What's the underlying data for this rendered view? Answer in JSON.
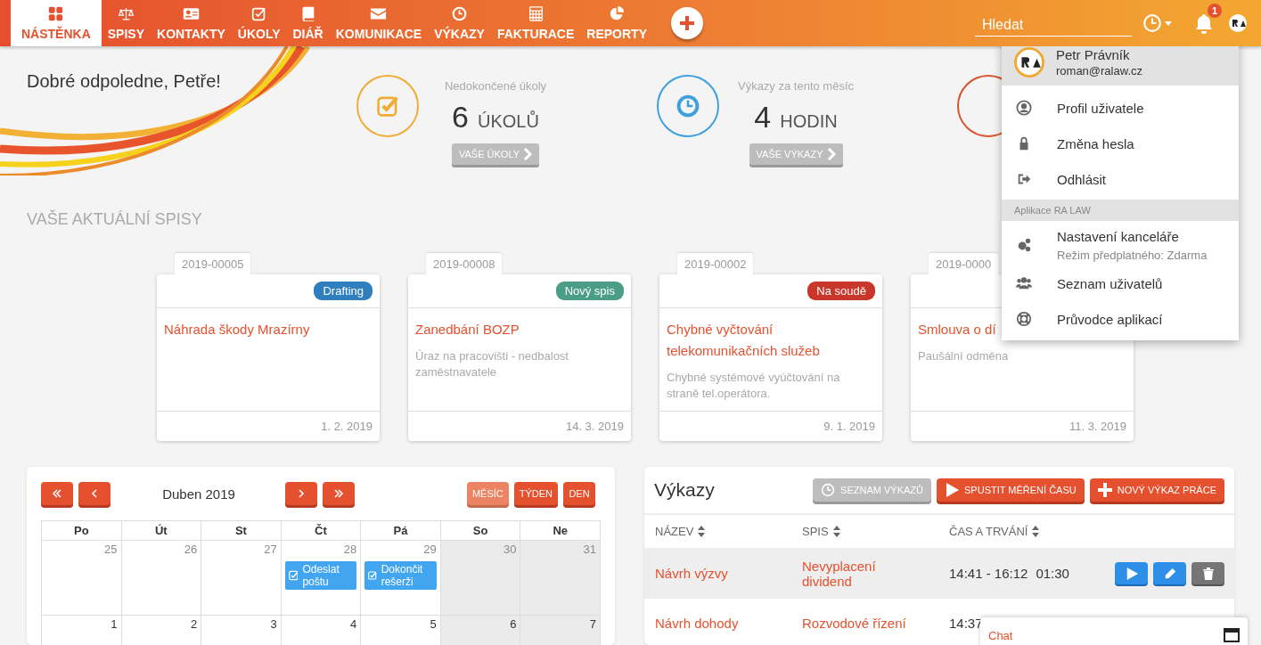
{
  "nav": {
    "items": [
      {
        "label": "NÁSTĚNKA",
        "selected": true
      },
      {
        "label": "SPISY",
        "selected": false
      },
      {
        "label": "KONTAKTY",
        "selected": false
      },
      {
        "label": "ÚKOLY",
        "selected": false
      },
      {
        "label": "DIÁŘ",
        "selected": false
      },
      {
        "label": "KOMUNIKACE",
        "selected": false
      },
      {
        "label": "VÝKAZY",
        "selected": false
      },
      {
        "label": "FAKTURACE",
        "selected": false
      },
      {
        "label": "REPORTY",
        "selected": false
      }
    ]
  },
  "search": {
    "placeholder": "Hledat"
  },
  "notifications": {
    "count": "1"
  },
  "user_menu": {
    "name": "Petr Právník",
    "email": "roman@ralaw.cz",
    "items": [
      {
        "label": "Profil uživatele"
      },
      {
        "label": "Změna hesla"
      },
      {
        "label": "Odhlásit"
      }
    ],
    "section": "Aplikace RA LAW",
    "app_items": [
      {
        "label": "Nastavení kanceláře",
        "subtitle": "Režim předplatného: Zdarma"
      },
      {
        "label": "Seznam uživatelů"
      },
      {
        "label": "Průvodce aplikací"
      }
    ]
  },
  "greeting": "Dobré odpoledne, Petře!",
  "stats": [
    {
      "label": "Nedokončené úkoly",
      "value": "6",
      "unit": "ÚKOLŮ",
      "button": "VAŠE ÚKOLY",
      "color": "#f0ac34"
    },
    {
      "label": "Výkazy za tento měsíc",
      "value": "4",
      "unit": "HODIN",
      "button": "VAŠE VÝKAZY",
      "color": "#3ea0dd"
    },
    {
      "color": "#d9532c"
    }
  ],
  "cases": {
    "title": "VAŠE AKTUÁLNÍ SPISY",
    "items": [
      {
        "number": "2019-00005",
        "status": "Drafting",
        "color": "#2f7fbf",
        "title": "Náhrada škody Mrazírny",
        "date": "1. 2. 2019"
      },
      {
        "number": "2019-00008",
        "status": "Nový spis",
        "color": "#4a9e85",
        "title": "Zanedbání BOZP",
        "description": "Úraz na pracovišti - nedbalost zaměstnavatele",
        "date": "14. 3. 2019"
      },
      {
        "number": "2019-00002",
        "status": "Na soudě",
        "color": "#c9362a",
        "title": "Chybné vyčtování telekomunikačních služeb",
        "description": "Chybné systémové vyúčtování na straně tel.operátora.",
        "date": "9. 1. 2019"
      },
      {
        "number": "2019-0000",
        "title": "Smlouva o dí",
        "description": "Paušální odměna",
        "date": "11. 3. 2019"
      }
    ]
  },
  "calendar": {
    "month": "Duben 2019",
    "views": [
      {
        "label": "MĚSÍC",
        "selected": true
      },
      {
        "label": "TÝDEN",
        "selected": false
      },
      {
        "label": "DEN",
        "selected": false
      }
    ],
    "weekdays": [
      "Po",
      "Út",
      "St",
      "Čt",
      "Pá",
      "So",
      "Ne"
    ],
    "weeks": [
      {
        "days": [
          {
            "label": "25",
            "other_month": true,
            "weekend": false
          },
          {
            "label": "26",
            "other_month": true,
            "weekend": false
          },
          {
            "label": "27",
            "other_month": true,
            "weekend": false
          },
          {
            "label": "28",
            "other_month": true,
            "weekend": false,
            "events": [
              {
                "label": "Odeslat poštu",
                "checked": true
              }
            ]
          },
          {
            "label": "29",
            "other_month": true,
            "weekend": false,
            "events": [
              {
                "label": "Dokončit rešerži",
                "checked": true
              }
            ]
          },
          {
            "label": "30",
            "other_month": true,
            "weekend": true
          },
          {
            "label": "31",
            "other_month": true,
            "weekend": true
          }
        ]
      },
      {
        "days": [
          {
            "label": "1",
            "other_month": false,
            "weekend": false
          },
          {
            "label": "2",
            "other_month": false,
            "weekend": false
          },
          {
            "label": "3",
            "other_month": false,
            "weekend": false
          },
          {
            "label": "4",
            "other_month": false,
            "weekend": false
          },
          {
            "label": "5",
            "other_month": false,
            "weekend": false
          },
          {
            "label": "6",
            "other_month": false,
            "weekend": true
          },
          {
            "label": "7",
            "other_month": false,
            "weekend": true
          }
        ]
      }
    ]
  },
  "reports": {
    "title": "Výkazy",
    "buttons": [
      {
        "label": "SEZNAM VÝKAZŮ",
        "kind": "secondary"
      },
      {
        "label": "SPUSTIT MĚŘENÍ ČASU",
        "kind": "start"
      },
      {
        "label": "NOVÝ VÝKAZ PRÁCE",
        "kind": "add"
      }
    ],
    "columns": [
      "NÁZEV",
      "SPIS",
      "ČAS A TRVÁNÍ"
    ],
    "rows": [
      {
        "name": "Návrh výzvy",
        "case": "Nevyplacení dividend",
        "time": "14:41 - 16:12",
        "duration": "01:30",
        "selected": true
      },
      {
        "name": "Návrh dohody",
        "case": "Rozvodové řízení",
        "time": "14:37",
        "selected": false
      }
    ]
  },
  "chat": {
    "title": "Chat"
  }
}
